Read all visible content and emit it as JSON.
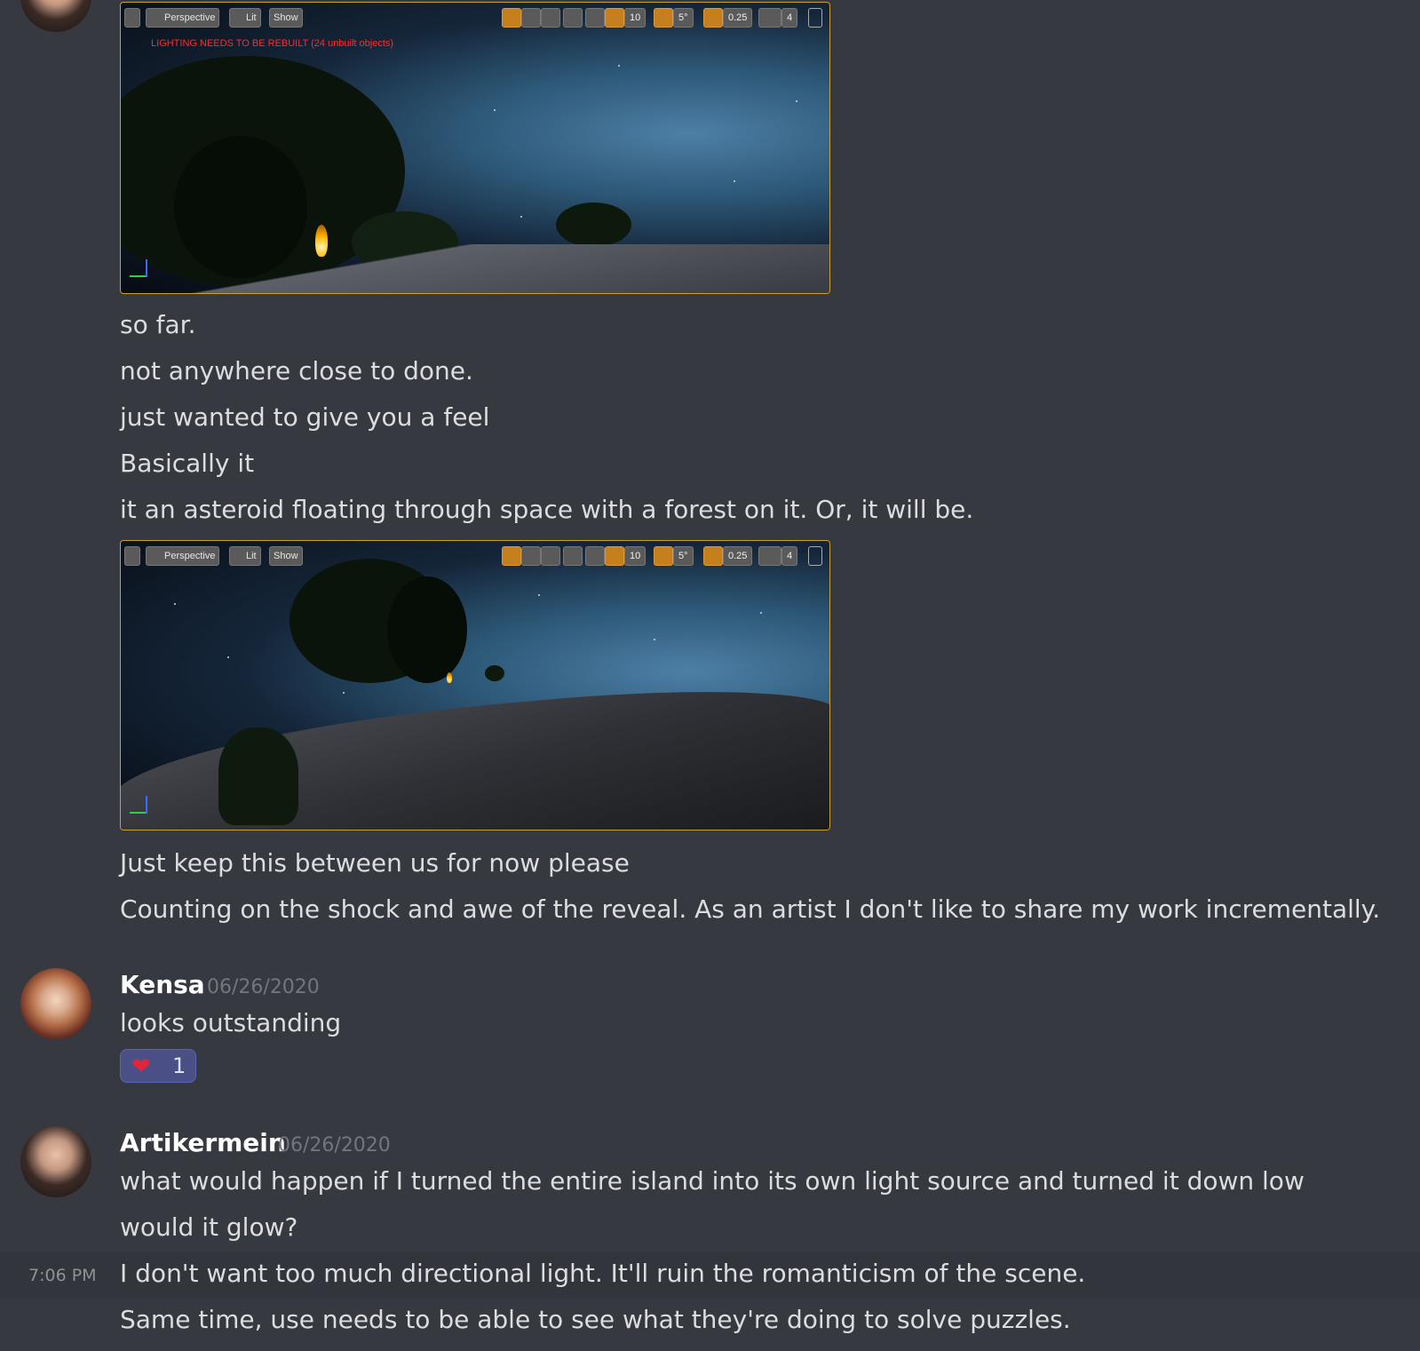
{
  "viewport_toolbar": {
    "perspective_label": "Perspective",
    "lit_label": "Lit",
    "show_label": "Show",
    "grid_snap_value": "10",
    "rotation_snap_value": "5°",
    "scale_snap_value": "0.25",
    "camera_speed_value": "4"
  },
  "screenshot1": {
    "warning": "LIGHTING NEEDS TO BE REBUILT (24 unbuilt objects)"
  },
  "message_group1": {
    "lines": [
      "so far.",
      "not anywhere close to done.",
      "just wanted to give you a feel",
      "Basically it",
      "it an asteroid floating through space with a forest on it. Or, it will be."
    ],
    "after_lines": [
      "Just keep this between us for now please",
      "Counting on the shock and awe of the reveal. As an artist I don't like to share my work incrementally."
    ]
  },
  "message_kensa": {
    "username": "Kensa",
    "date": "06/26/2020",
    "text": "looks outstanding",
    "reaction": {
      "emoji": "❤",
      "count": "1"
    }
  },
  "message_artikermein": {
    "username": "Artikermein",
    "date": "06/26/2020",
    "lines": [
      "what would happen if I turned the entire island into its own light source and turned it down low",
      "would it glow?",
      "I don't want too much directional light. It'll ruin the romanticism of the scene.",
      "Same time, use needs to be able to see what they're doing to solve puzzles."
    ],
    "hover_time": "7:06 PM"
  },
  "colors": {
    "background": "#36393f",
    "text": "#dcddde",
    "username": "#ffffff",
    "timestamp": "#72767d",
    "reaction_bg": "#4a5086",
    "viewport_border": "#c9a227",
    "warning": "#ff2b2b"
  }
}
